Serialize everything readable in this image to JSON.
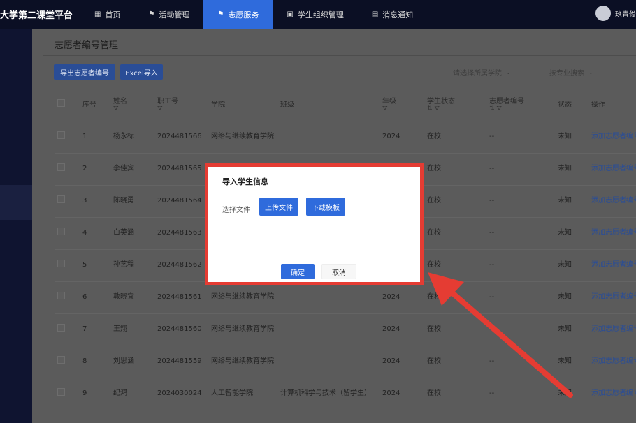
{
  "header": {
    "brand": "大学第二课堂平台",
    "nav": [
      {
        "icon": "home-icon",
        "glyph": "▦",
        "label": "首页",
        "active": false
      },
      {
        "icon": "flag-icon",
        "glyph": "⚑",
        "label": "活动管理",
        "active": false
      },
      {
        "icon": "flag-icon",
        "glyph": "⚑",
        "label": "志愿服务",
        "active": true
      },
      {
        "icon": "group-icon",
        "glyph": "▣",
        "label": "学生组织管理",
        "active": false
      },
      {
        "icon": "message-icon",
        "glyph": "▤",
        "label": "消息通知",
        "active": false
      }
    ],
    "user_name": "玖青俊"
  },
  "page": {
    "title": "志愿者编号管理",
    "export_button": "导出志愿者编号",
    "excel_import_button": "Excel导入",
    "college_select_placeholder": "请选择所属学院",
    "major_select_placeholder": "按专业搜索"
  },
  "table": {
    "columns": [
      "序号",
      "姓名",
      "职工号",
      "学院",
      "班级",
      "年级",
      "学生状态",
      "志愿者编号",
      "状态",
      "操作"
    ],
    "rows": [
      {
        "no": "1",
        "name": "杨永标",
        "id": "2024481566",
        "college": "网络与继续教育学院",
        "class": "",
        "grade": "2024",
        "student_status": "在校",
        "vol_no": "--",
        "status": "未知",
        "action": "添加志愿者编号"
      },
      {
        "no": "2",
        "name": "李佳宾",
        "id": "2024481565",
        "college": "",
        "class": "",
        "grade": "",
        "student_status": "在校",
        "vol_no": "--",
        "status": "未知",
        "action": "添加志愿者编号"
      },
      {
        "no": "3",
        "name": "陈晓勇",
        "id": "2024481564",
        "college": "",
        "class": "",
        "grade": "",
        "student_status": "在校",
        "vol_no": "--",
        "status": "未知",
        "action": "添加志愿者编号"
      },
      {
        "no": "4",
        "name": "白英涵",
        "id": "2024481563",
        "college": "",
        "class": "",
        "grade": "",
        "student_status": "在校",
        "vol_no": "--",
        "status": "未知",
        "action": "添加志愿者编号"
      },
      {
        "no": "5",
        "name": "孙艺程",
        "id": "2024481562",
        "college": "",
        "class": "",
        "grade": "",
        "student_status": "在校",
        "vol_no": "--",
        "status": "未知",
        "action": "添加志愿者编号"
      },
      {
        "no": "6",
        "name": "敦晓宜",
        "id": "2024481561",
        "college": "网络与继续教育学院",
        "class": "",
        "grade": "2024",
        "student_status": "在校",
        "vol_no": "--",
        "status": "未知",
        "action": "添加志愿者编号"
      },
      {
        "no": "7",
        "name": "王翔",
        "id": "2024481560",
        "college": "网络与继续教育学院",
        "class": "",
        "grade": "2024",
        "student_status": "在校",
        "vol_no": "--",
        "status": "未知",
        "action": "添加志愿者编号"
      },
      {
        "no": "8",
        "name": "刘思涵",
        "id": "2024481559",
        "college": "网络与继续教育学院",
        "class": "",
        "grade": "2024",
        "student_status": "在校",
        "vol_no": "--",
        "status": "未知",
        "action": "添加志愿者编号"
      },
      {
        "no": "9",
        "name": "纪鸿",
        "id": "2024030024",
        "college": "人工智能学院",
        "class": "计算机科学与技术（留学生）",
        "grade": "2024",
        "student_status": "在校",
        "vol_no": "--",
        "status": "未知",
        "action": "添加志愿者编号"
      }
    ]
  },
  "modal": {
    "title": "导入学生信息",
    "file_label": "选择文件",
    "upload_button": "上传文件",
    "download_template_button": "下载模板",
    "confirm_button": "确定",
    "cancel_button": "取消"
  },
  "colors": {
    "primary": "#2f6bdc",
    "highlight_border": "#e53c33",
    "topbar": "#0b0f24"
  }
}
